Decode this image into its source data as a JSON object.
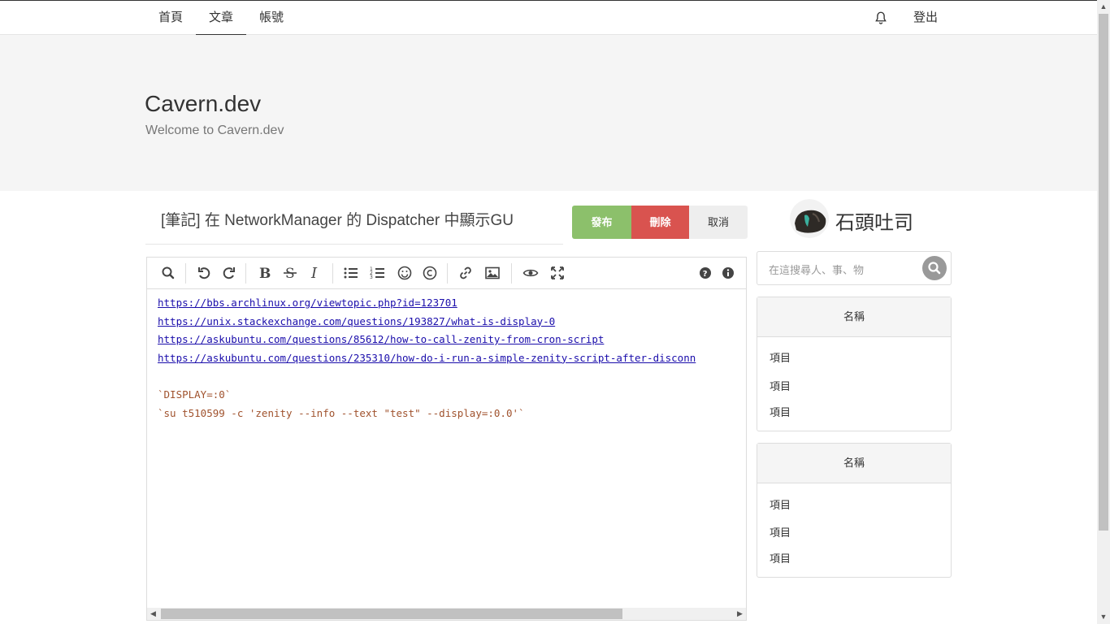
{
  "nav": {
    "items": [
      {
        "label": "首頁"
      },
      {
        "label": "文章"
      },
      {
        "label": "帳號"
      }
    ],
    "logout": "登出"
  },
  "hero": {
    "title": "Cavern.dev",
    "subtitle": "Welcome to Cavern.dev"
  },
  "post": {
    "title": "[筆記] 在 NetworkManager 的 Dispatcher 中顯示GU",
    "publish": "發布",
    "delete": "刪除",
    "cancel": "取消"
  },
  "editor": {
    "lines": [
      "https://bbs.archlinux.org/viewtopic.php?id=123701",
      "https://unix.stackexchange.com/questions/193827/what-is-display-0",
      "https://askubuntu.com/questions/85612/how-to-call-zenity-from-cron-script",
      "https://askubuntu.com/questions/235310/how-do-i-run-a-simple-zenity-script-after-disconn",
      "",
      "`DISPLAY=:0`",
      "`su t510599 -c 'zenity --info --text \"test\" --display=:0.0'`"
    ]
  },
  "sidebar": {
    "username": "石頭吐司",
    "search_placeholder": "在這搜尋人、事、物",
    "panels": [
      {
        "title": "名稱",
        "items": [
          "項目",
          "項目",
          "項目"
        ]
      },
      {
        "title": "名稱",
        "items": [
          "項目",
          "項目",
          "項目"
        ]
      }
    ]
  },
  "colors": {
    "publish": "#8cc06b",
    "delete": "#d9534f",
    "cancel": "#eeeeee",
    "hero_bg": "#f5f5f5"
  }
}
